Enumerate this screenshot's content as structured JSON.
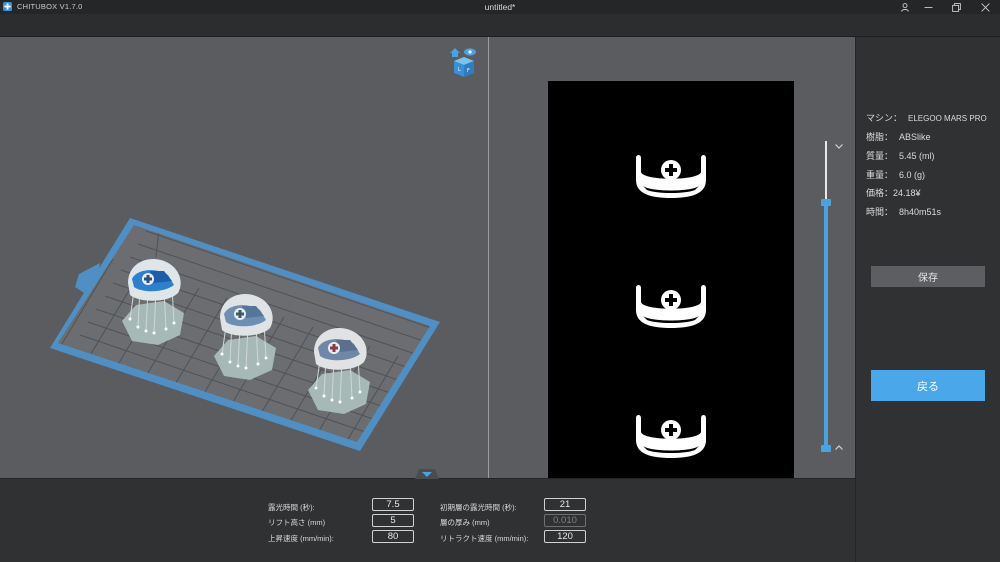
{
  "titlebar": {
    "app_name": "CHITUBOX V1.7.0",
    "doc_title": "untitled*"
  },
  "machine_info": [
    {
      "key": "マシン：",
      "value": "ELEGOO MARS PRO"
    },
    {
      "key": "樹脂：",
      "value": "ABSlike"
    },
    {
      "key": "質量：",
      "value": "5.45  (ml)"
    },
    {
      "key": "重量：",
      "value": "6.0  (g)"
    },
    {
      "key": "価格：",
      "value": "24.18¥"
    },
    {
      "key": "時間：",
      "value": "8h40m51s"
    }
  ],
  "buttons": {
    "save": "保存",
    "back": "戻る"
  },
  "params": {
    "exposure_time": {
      "label": "露光時間 (秒):",
      "value": "7.5"
    },
    "lift_height": {
      "label": "リフト高さ (mm)",
      "value": "5"
    },
    "lift_speed": {
      "label": "上昇速度 (mm/min):",
      "value": "80"
    },
    "bottom_exposure": {
      "label": "初期層の露光時間 (秒):",
      "value": "21"
    },
    "layer_height": {
      "label": "層の厚み (mm)",
      "value": "0.010"
    },
    "retract_speed": {
      "label": "リトラクト速度 (mm/min):",
      "value": "120"
    }
  },
  "colors": {
    "accent": "#4aa8ea",
    "build_plate_frame": "#4f8fc4",
    "grid": "#4c4e50"
  },
  "icons": {
    "app": "chitubox-logo-icon",
    "user": "user-icon",
    "minimize": "minimize-icon",
    "restore": "restore-icon",
    "close": "close-icon",
    "view_cube": "view-cube-icon",
    "slider_up": "chevron-up-icon",
    "slider_down": "chevron-down-icon",
    "collapse": "triangle-down-icon"
  }
}
